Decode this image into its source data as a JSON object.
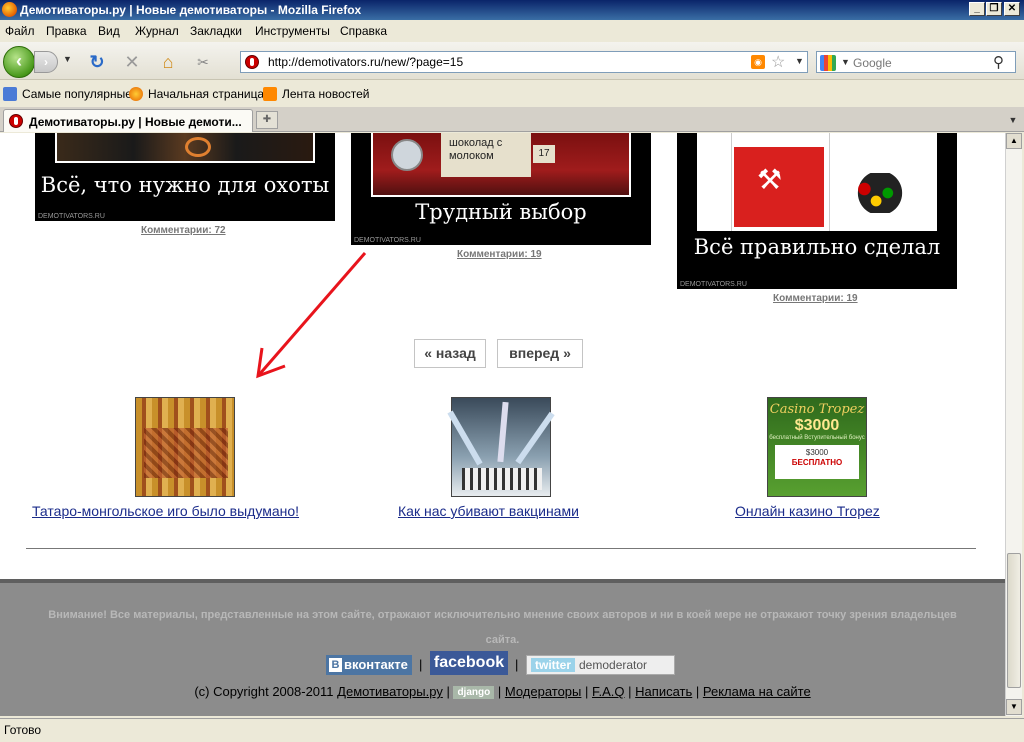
{
  "window": {
    "title": "Демотиваторы.ру | Новые демотиваторы - Mozilla Firefox",
    "minimize_glyph": "_",
    "restore_glyph": "❐",
    "close_glyph": "✕"
  },
  "menu": [
    "Файл",
    "Правка",
    "Вид",
    "Журнал",
    "Закладки",
    "Инструменты",
    "Справка"
  ],
  "toolbar": {
    "url": "http://demotivators.ru/new/?page=15",
    "search_placeholder": "Google",
    "back_glyph": "‹",
    "forward_glyph": "›",
    "reload_glyph": "↻",
    "stop_glyph": "✕",
    "home_glyph": "⌂"
  },
  "bookmarks": [
    "Самые популярные",
    "Начальная страница",
    "Лента новостей"
  ],
  "tabs": [
    {
      "title": "Демотиваторы.ру | Новые демоти..."
    }
  ],
  "posters": [
    {
      "caption": "Всё, что нужно для охоты",
      "watermark": "DEMOTIVATORS.RU",
      "comments": "Комментарии: 72"
    },
    {
      "caption": "Трудный выбор",
      "watermark": "DEMOTIVATORS.RU",
      "comments": "Комментарии: 19",
      "pic_text": "шоколад с молоком",
      "pic_num": "17"
    },
    {
      "caption": "Всё правильно сделал",
      "watermark": "DEMOTIVATORS.RU",
      "comments": "Комментарии: 19"
    }
  ],
  "pager": {
    "prev": "« назад",
    "next": "вперед »"
  },
  "related": [
    {
      "label": "Татаро-монгольское иго было выдумано!"
    },
    {
      "label": "Как нас убивают вакцинами"
    },
    {
      "label": "Онлайн казино Tropez",
      "ad_title": "Casino Tropez",
      "ad_amount": "$3000",
      "ad_small": "бесплатный Вступительный бонус",
      "ad_amount2": "$3000",
      "ad_free": "БЕСПЛАТНО"
    }
  ],
  "footer": {
    "notice": "Внимание! Все материалы, представленные на этом сайте, отражают исключительно мнение своих авторов и ни в коей мере не отражают точку зрения владельцев сайта.",
    "vk": "вконтакте",
    "vk_letter": "В",
    "facebook": "facebook",
    "twitter": "twitter",
    "twitter_user": "demoderator",
    "copyright": "(c) Copyright 2008-2011",
    "site_link": "Демотиваторы.ру",
    "django": "django",
    "links": [
      "Модераторы",
      "F.A.Q",
      "Написать",
      "Реклама на сайте"
    ]
  },
  "status": "Готово",
  "colors": {
    "annotation_arrow": "#e8141c",
    "link": "#1a2b8a",
    "footer_bg": "#8c8c8c"
  }
}
